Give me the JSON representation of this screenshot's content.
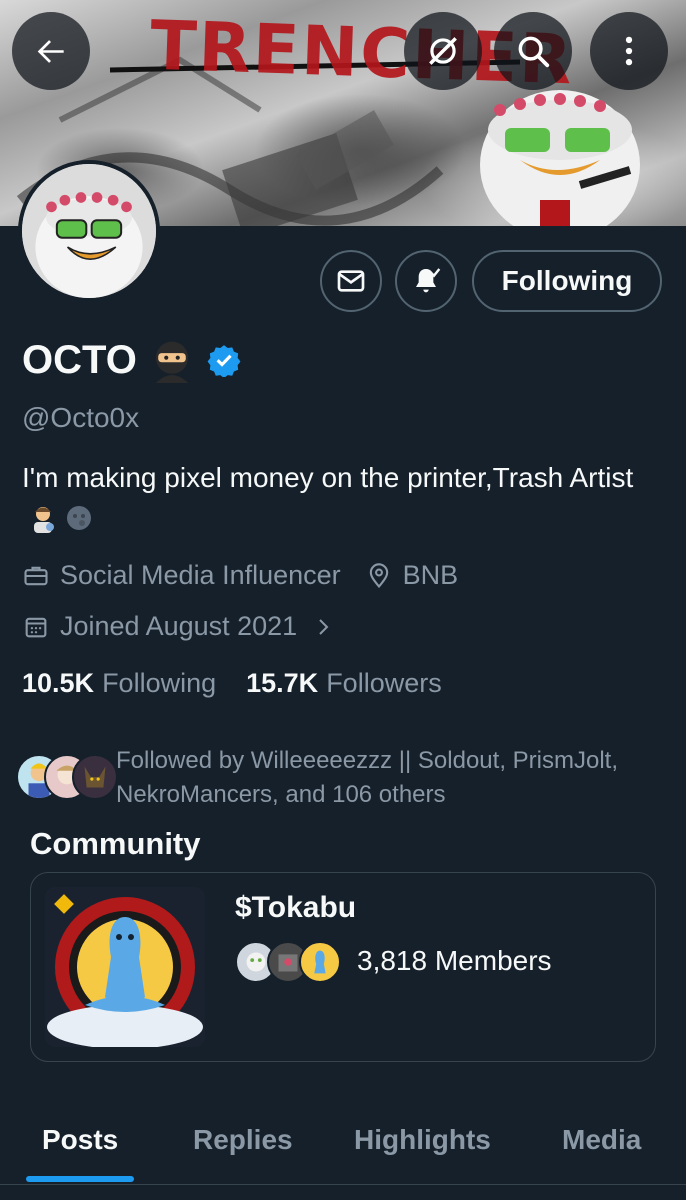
{
  "banner": {
    "art_text": "TRENCHER",
    "buttons": {
      "back_icon": "arrow-left-icon",
      "grok_icon": "grok-icon",
      "search_icon": "search-icon",
      "more_icon": "more-vertical-icon"
    }
  },
  "actions": {
    "message_icon": "mail-icon",
    "notify_icon": "bell-check-icon",
    "following_label": "Following"
  },
  "profile": {
    "display_name": "OCTO",
    "name_emoji": "ninja-emoji",
    "verified_icon": "verified-badge-icon",
    "handle": "@Octo0x",
    "bio_text": "I'm making pixel money on the printer,Trash Artist",
    "bio_emojis": [
      "artist-emoji",
      "new-moon-face-emoji"
    ],
    "category": "Social Media Influencer",
    "location": "BNB",
    "joined": "Joined August 2021",
    "following_count": "10.5K",
    "following_label": "Following",
    "followers_count": "15.7K",
    "followers_label": "Followers",
    "followed_by_text": "Followed by Willeeeeezzz || Soldout, PrismJolt, NekroMancers, and 106 others"
  },
  "community": {
    "heading": "Community",
    "name": "$Tokabu",
    "members": "3,818 Members"
  },
  "tabs": [
    {
      "label": "Posts",
      "active": true
    },
    {
      "label": "Replies",
      "active": false
    },
    {
      "label": "Highlights",
      "active": false
    },
    {
      "label": "Media",
      "active": false
    }
  ],
  "colors": {
    "background": "#15202b",
    "accent": "#1d9bf0",
    "secondary_text": "#8b98a5",
    "border": "#536471"
  }
}
